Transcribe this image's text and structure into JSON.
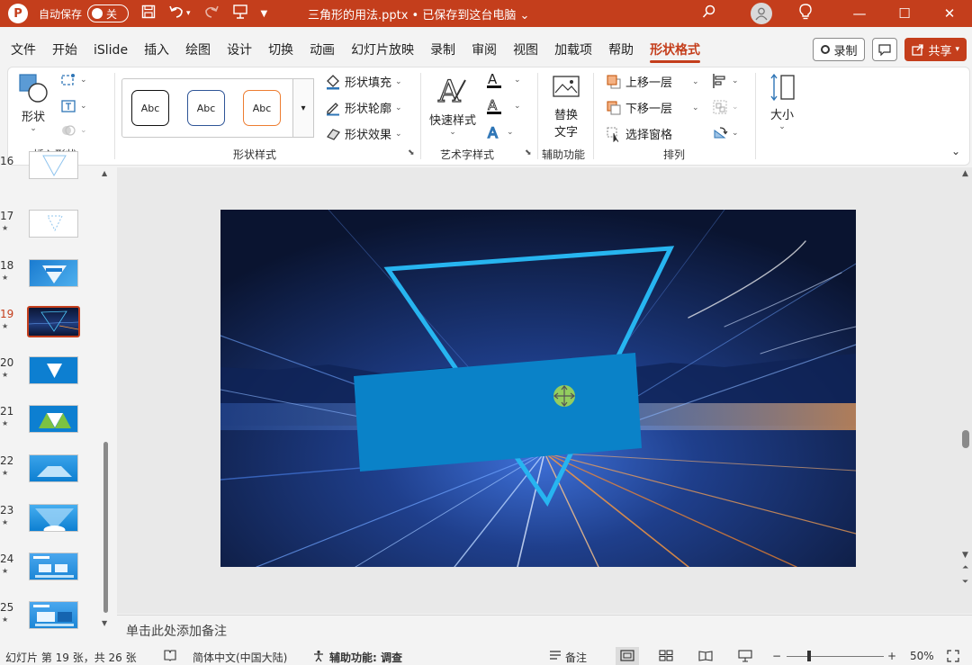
{
  "titlebar": {
    "logo": "P",
    "autosave_label": "自动保存",
    "toggle_state": "关",
    "doc_title": "三角形的用法.pptx • 已保存到这台电脑 ⌄",
    "icons": [
      "save-icon",
      "undo-icon",
      "redo-icon",
      "present-icon",
      "customize-icon",
      "search-icon",
      "avatar-icon",
      "lightbulb-icon"
    ]
  },
  "menu": {
    "tabs": [
      "文件",
      "开始",
      "iSlide",
      "插入",
      "绘图",
      "设计",
      "切换",
      "动画",
      "幻灯片放映",
      "录制",
      "审阅",
      "视图",
      "加载项",
      "帮助",
      "形状格式"
    ],
    "active_tab": "形状格式",
    "record_label": "录制",
    "share_label": "共享"
  },
  "ribbon": {
    "insert_shape": {
      "shape_label": "形状",
      "group_label": "插入形状"
    },
    "shape_styles": {
      "abc": [
        "Abc",
        "Abc",
        "Abc"
      ],
      "fill_label": "形状填充",
      "outline_label": "形状轮廓",
      "effects_label": "形状效果",
      "group_label": "形状样式"
    },
    "wordart": {
      "quick_label": "快速样式",
      "group_label": "艺术字样式"
    },
    "accessibility": {
      "alt_text_line1": "替换",
      "alt_text_line2": "文字",
      "group_label": "辅助功能"
    },
    "arrange": {
      "bring_forward": "上移一层",
      "send_backward": "下移一层",
      "selection_pane": "选择窗格",
      "group_label": "排列"
    },
    "size": {
      "label": "大小"
    }
  },
  "thumbnails": [
    {
      "num": "16"
    },
    {
      "num": "17"
    },
    {
      "num": "18"
    },
    {
      "num": "19",
      "selected": true
    },
    {
      "num": "20"
    },
    {
      "num": "21"
    },
    {
      "num": "22"
    },
    {
      "num": "23"
    },
    {
      "num": "24"
    },
    {
      "num": "25"
    }
  ],
  "thumb_star": "★",
  "notes_placeholder": "单击此处添加备注",
  "status": {
    "slide_info": "幻灯片 第 19 张，共 26 张",
    "language": "简体中文(中国大陆)",
    "accessibility": "辅助功能: 调查",
    "notes_label": "备注",
    "zoom_minus": "−",
    "zoom_plus": "+",
    "zoom_level": "50%"
  },
  "colors": {
    "accent": "#c43e1c",
    "shape_fill": "#0a82c8",
    "triangle_stroke": "#27b5f0"
  }
}
